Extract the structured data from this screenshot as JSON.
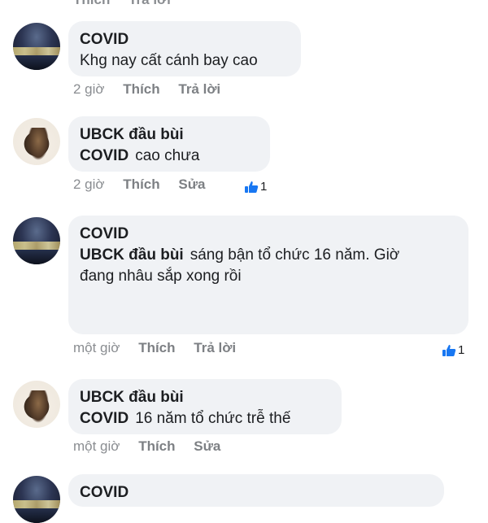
{
  "top_actions": [
    "Thích",
    "Trả lời"
  ],
  "comments": [
    {
      "author": "COVID",
      "mention": "",
      "text": "Khg nay cất cánh bay cao",
      "time": "2 giờ",
      "like_label": "Thích",
      "action_label": "Trả lời",
      "reactions": ""
    },
    {
      "author": "UBCK đầu bùi",
      "mention": "COVID",
      "text": "cao chưa",
      "time": "2 giờ",
      "like_label": "Thích",
      "action_label": "Sửa",
      "reactions": "1"
    },
    {
      "author": "COVID",
      "mention": "UBCK đầu bùi",
      "text": "sáng bận tổ chức 16 năm. Giờ",
      "text2": "đang nhâu sắp xong rồi",
      "time": "một giờ",
      "like_label": "Thích",
      "action_label": "Trả lời",
      "reactions": "1"
    },
    {
      "author": "UBCK đầu bùi",
      "mention": "COVID",
      "text": "16 năm tổ chức trễ thế",
      "time": "một giờ",
      "like_label": "Thích",
      "action_label": "Sửa",
      "reactions": ""
    },
    {
      "author": "COVID"
    }
  ],
  "colors": {
    "bubble": "#f0f2f5",
    "meta": "#8a8d91",
    "like_blue": "#1877f2"
  }
}
